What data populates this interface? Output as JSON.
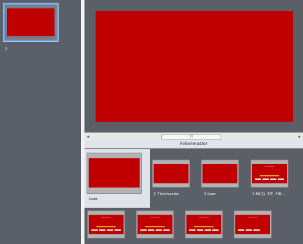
{
  "slides_panel": {
    "items": [
      {
        "number": "1"
      }
    ]
  },
  "scrollbar": {
    "left_arrow": "◂",
    "right_arrow": "▸",
    "thumb_grip": "III"
  },
  "layout_panel": {
    "title": "Folienmaster",
    "layouts": [
      {
        "label": "Leer",
        "selected": true
      },
      {
        "label": "1 Titelmaster"
      },
      {
        "label": "2 Leer"
      },
      {
        "label": "3 MCQ, T/F, FIB..."
      },
      {
        "label": ""
      },
      {
        "label": ""
      },
      {
        "label": ""
      },
      {
        "label": ""
      }
    ]
  },
  "colors": {
    "slide_fill": "#c00000",
    "selection_border": "#6a9fe0",
    "accent_bar": "#f0a020",
    "workspace": "#5b5f68"
  }
}
